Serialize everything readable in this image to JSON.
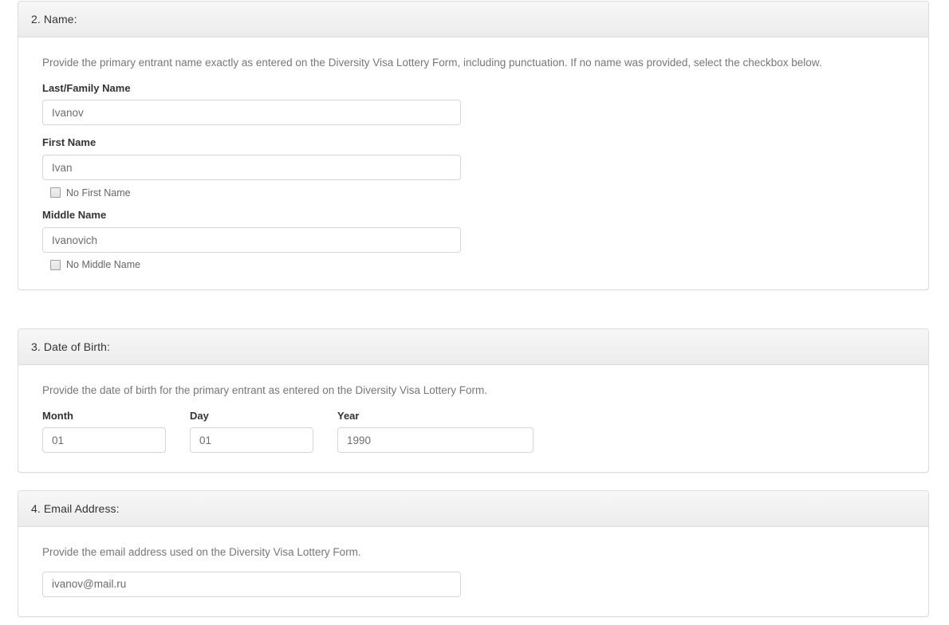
{
  "sections": [
    {
      "id": "name",
      "title": "2. Name:",
      "help": "Provide the primary entrant name exactly as entered on the Diversity Visa Lottery Form, including punctuation. If no name was provided, select the checkbox below.",
      "fields": {
        "last_name": {
          "label": "Last/Family Name",
          "value": "Ivanov",
          "placeholder": ""
        },
        "first_name": {
          "label": "First Name",
          "value": "Ivan",
          "placeholder": ""
        },
        "middle_name": {
          "label": "Middle Name",
          "value": "Ivanovich",
          "placeholder": ""
        }
      },
      "checkboxes": {
        "no_first_name": {
          "label": "No First Name",
          "checked": false
        },
        "no_middle_name": {
          "label": "No Middle Name",
          "checked": false
        }
      }
    },
    {
      "id": "dob",
      "title": "3. Date of Birth:",
      "help": "Provide the date of birth for the primary entrant as entered on the Diversity Visa Lottery Form.",
      "fields": {
        "month": {
          "label": "Month",
          "value": "01",
          "placeholder": ""
        },
        "day": {
          "label": "Day",
          "value": "01",
          "placeholder": ""
        },
        "year": {
          "label": "Year",
          "value": "1990",
          "placeholder": ""
        }
      }
    },
    {
      "id": "email",
      "title": "4. Email Address:",
      "help": "Provide the email address used on the Diversity Visa Lottery Form.",
      "fields": {
        "email": {
          "label": "",
          "value": "ivanov@mail.ru",
          "placeholder": ""
        }
      }
    }
  ],
  "colors": {
    "panel_border": "#dddddd",
    "heading_top": "#f7f7f7",
    "heading_bottom": "#ececec",
    "title_text": "#333333",
    "help_text": "#777777",
    "label_text": "#333333",
    "input_border": "#d6d6d6",
    "input_text": "#6d6d6d",
    "page_background": "#ffffff"
  }
}
